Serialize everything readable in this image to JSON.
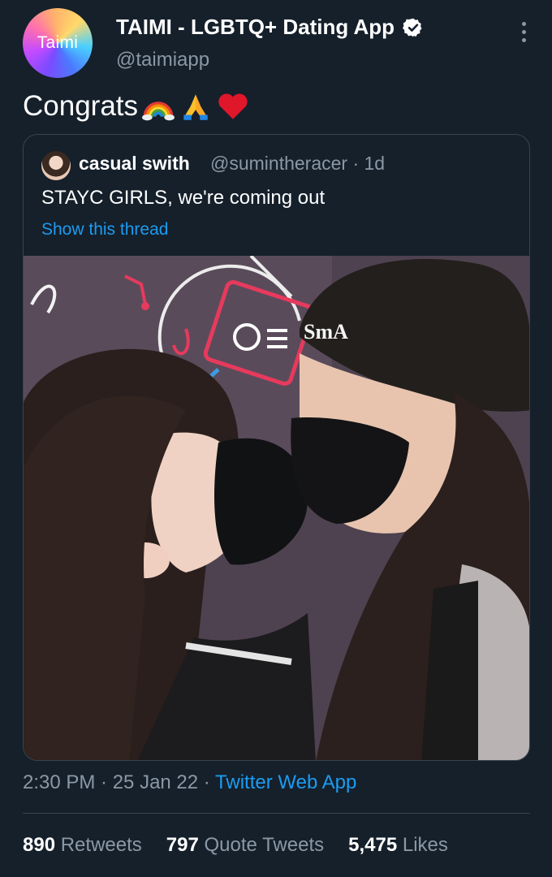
{
  "author": {
    "avatar_text": "Taimi",
    "display_name": "TAIMI - LGBTQ+ Dating App",
    "handle": "@taimiapp",
    "verified": true
  },
  "tweet": {
    "text": "Congrats",
    "emojis": [
      "rainbow-emoji",
      "folded-hands-emoji",
      "red-heart-emoji"
    ]
  },
  "quoted_tweet": {
    "display_name": "casual swith",
    "handle_time": "@sumintheracer · 1d",
    "text": "STAYC GIRLS, we're coming out",
    "show_thread": "Show this thread",
    "photo_hat_text": "SmA"
  },
  "meta": {
    "time_date": "2:30 PM · 25 Jan 22 · ",
    "source": "Twitter Web App"
  },
  "stats": {
    "retweets_count": "890",
    "retweets_label": "Retweets",
    "quotes_count": "797",
    "quotes_label": "Quote Tweets",
    "likes_count": "5,475",
    "likes_label": "Likes"
  },
  "colors": {
    "background": "#15202b",
    "secondary_text": "#8b98a5",
    "link": "#1d9bf0",
    "border": "#38444d"
  }
}
